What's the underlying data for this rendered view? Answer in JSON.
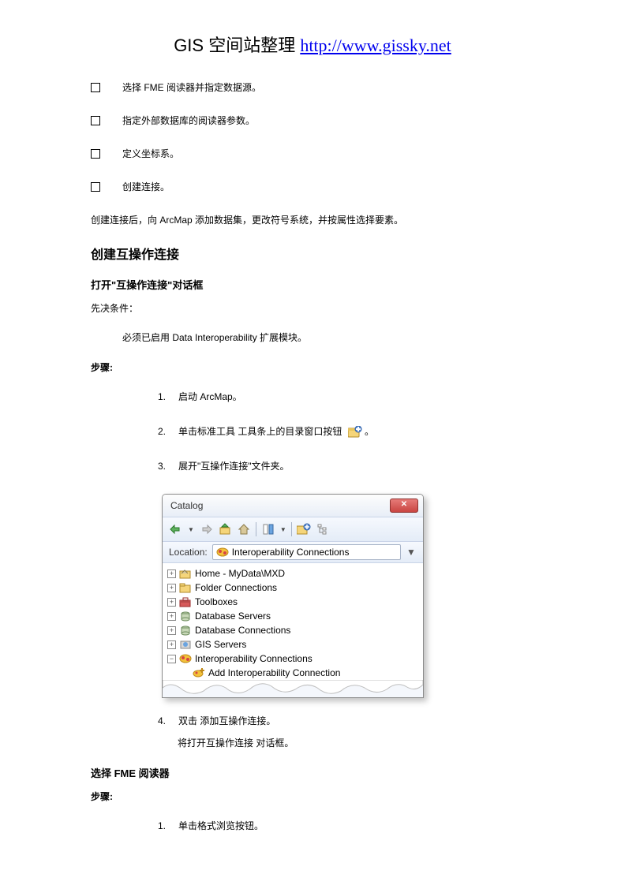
{
  "header": {
    "title_prefix": "GIS 空间站整理  ",
    "link_text": "http://www.gissky.net"
  },
  "bullets": [
    "选择 FME 阅读器并指定数据源。",
    "指定外部数据库的阅读器参数。",
    "定义坐标系。",
    "创建连接。"
  ],
  "after_bullets": "创建连接后，向 ArcMap 添加数据集，更改符号系统，并按属性选择要素。",
  "h2_1": "创建互操作连接",
  "h3_1": "打开\"互操作连接\"对话框",
  "prereq_label": "先决条件：",
  "prereq_text": "必须已启用 Data Interoperability 扩展模块。",
  "steps_label": "步骤:",
  "steps_a": {
    "1": "启动 ArcMap。",
    "2": "单击标准工具 工具条上的目录窗口按钮",
    "3": "展开\"互操作连接\"文件夹。",
    "4": "双击 添加互操作连接。",
    "4_sub": "将打开互操作连接 对话框。"
  },
  "catalog": {
    "title": "Catalog",
    "location_label": "Location:",
    "location_value": "Interoperability Connections",
    "tree": {
      "home": "Home - MyData\\MXD",
      "folder": "Folder Connections",
      "toolboxes": "Toolboxes",
      "dbservers": "Database Servers",
      "dbconn": "Database Connections",
      "gisservers": "GIS Servers",
      "interop": "Interoperability Connections",
      "addinterop": "Add Interoperability Connection"
    }
  },
  "h3_2": "选择 FME 阅读器",
  "steps_label_2": "步骤:",
  "steps_b": {
    "1": "单击格式浏览按钮。"
  }
}
